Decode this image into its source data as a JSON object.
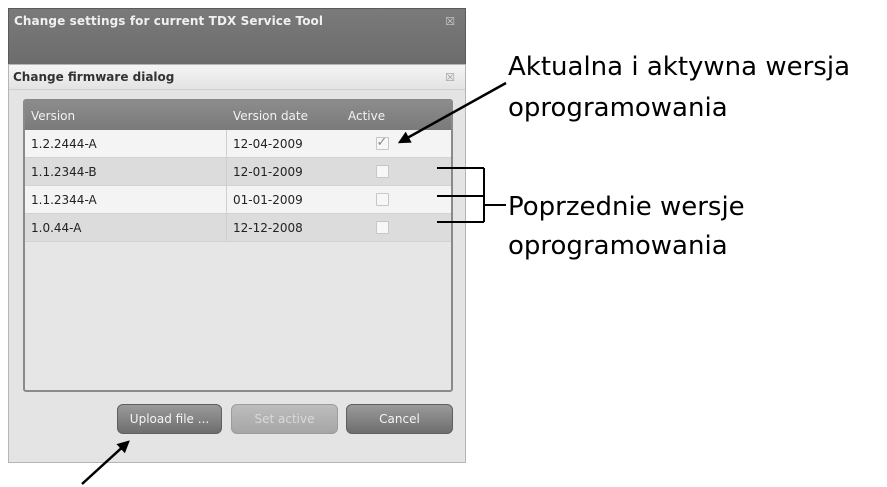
{
  "outer_window": {
    "title": "Change settings for current TDX Service Tool",
    "close_glyph": "☒"
  },
  "dialog": {
    "title": "Change firmware dialog",
    "close_glyph": "☒",
    "table": {
      "columns": [
        "Version",
        "Version date",
        "Active"
      ],
      "rows": [
        {
          "version": "1.2.2444-A",
          "date": "12-04-2009",
          "active": true
        },
        {
          "version": "1.1.2344-B",
          "date": "12-01-2009",
          "active": false
        },
        {
          "version": "1.1.2344-A",
          "date": "01-01-2009",
          "active": false
        },
        {
          "version": "1.0.44-A",
          "date": "12-12-2008",
          "active": false
        }
      ]
    },
    "buttons": {
      "upload": "Upload file ...",
      "set_active": "Set active",
      "cancel": "Cancel"
    }
  },
  "annotations": {
    "current_version_line1": "Aktualna i aktywna wersja",
    "current_version_line2": "oprogramowania",
    "previous_versions_line1": "Poprzednie wersje",
    "previous_versions_line2": "oprogramowania"
  }
}
